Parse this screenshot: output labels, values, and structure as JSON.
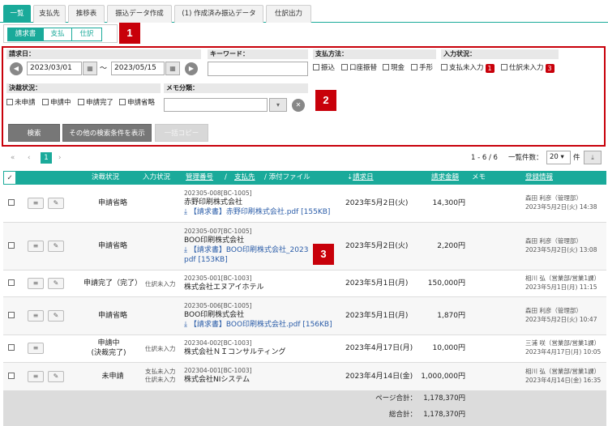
{
  "tabs": [
    {
      "label": "一覧",
      "active": true
    },
    {
      "label": "支払先"
    },
    {
      "label": "推移表"
    },
    {
      "label": "振込データ作成"
    },
    {
      "label": "(1) 作成済み振込データ"
    },
    {
      "label": "仕訳出力"
    }
  ],
  "subtabs": [
    {
      "label": "請求書",
      "active": true
    },
    {
      "label": "支払"
    },
    {
      "label": "仕訳"
    }
  ],
  "callouts": [
    "1",
    "2",
    "3"
  ],
  "search": {
    "date_label": "請求日：",
    "date_from": "2023/03/01",
    "date_sep": "～",
    "date_to": "2023/05/15",
    "keyword_label": "キーワード：",
    "keyword_value": "",
    "paymethod_label": "支払方法：",
    "paymethods": [
      "振込",
      "口座振替",
      "現金",
      "手形"
    ],
    "input_label": "入力状況：",
    "input_opts": [
      {
        "label": "支払未入力",
        "badge": "1"
      },
      {
        "label": "仕訳未入力",
        "badge": "3"
      }
    ],
    "approval_label": "決裁状況：",
    "approval_opts": [
      "未申請",
      "申請中",
      "申請完了",
      "申請省略"
    ],
    "memo_label": "メモ分類：",
    "memo_value": "",
    "search_btn": "検索",
    "more_btn": "その他の検索条件を表示",
    "copy_btn": "一括コピー"
  },
  "pager": {
    "first": "«",
    "prev": "‹",
    "current": "1",
    "next": "›",
    "range": "1 - 6 / 6",
    "per_label": "一覧件数：",
    "per_value": "20",
    "per_unit": "件"
  },
  "columns": {
    "check": "✓",
    "approval": "決裁状況",
    "input": "入力状況",
    "mgmt_no": "管理番号",
    "sep1": "/",
    "payee": "支払先",
    "sep2": "/ 添付ファイル",
    "date": "請求日",
    "amount": "請求金額",
    "memo": "メモ",
    "reg": "登録情報"
  },
  "rows": [
    {
      "approval": "申請省略",
      "approval2": "",
      "input1": "",
      "input2": "",
      "id": "202305-008[BC-1005]",
      "company": "赤野印刷株式会社",
      "file": "【請求書】赤野印刷株式会社.pdf [155KB]",
      "file2": "",
      "date": "2023年5月2日(火)",
      "amount": "14,300円",
      "user": "森田 利彦（管理部）",
      "ts": "2023年5月2日(火) 14:38",
      "edit": true
    },
    {
      "approval": "申請省略",
      "approval2": "",
      "input1": "",
      "input2": "",
      "id": "202305-007[BC-1005]",
      "company": "BOO印刷株式会社",
      "file": "【請求書】BOO印刷株式会社_2023",
      "file2": "pdf [153KB]",
      "date": "2023年5月2日(火)",
      "amount": "2,200円",
      "user": "森田 利彦（管理部）",
      "ts": "2023年5月2日(火) 13:08",
      "edit": true
    },
    {
      "approval": "申請完了（完了）",
      "approval2": "",
      "input1": "仕訳未入力",
      "input2": "",
      "id": "202305-001[BC-1003]",
      "company": "株式会社エヌアイホテル",
      "file": "",
      "file2": "",
      "date": "2023年5月1日(月)",
      "amount": "150,000円",
      "user": "相川 弘（営業部/営業1課）",
      "ts": "2023年5月1日(月) 11:15",
      "edit": true
    },
    {
      "approval": "申請省略",
      "approval2": "",
      "input1": "",
      "input2": "",
      "id": "202305-006[BC-1005]",
      "company": "BOO印刷株式会社",
      "file": "【請求書】BOO印刷株式会社.pdf [156KB]",
      "file2": "",
      "date": "2023年5月1日(月)",
      "amount": "1,870円",
      "user": "森田 利彦（管理部）",
      "ts": "2023年5月2日(火) 10:47",
      "edit": true
    },
    {
      "approval": "申請中",
      "approval2": "(決裁完了)",
      "input1": "仕訳未入力",
      "input2": "",
      "id": "202304-002[BC-1003]",
      "company": "株式会社ＮＩコンサルティング",
      "file": "",
      "file2": "",
      "date": "2023年4月17日(月)",
      "amount": "10,000円",
      "user": "三浦 咲（営業部/営業1課）",
      "ts": "2023年4月17日(月) 10:05",
      "edit": false
    },
    {
      "approval": "未申請",
      "approval2": "",
      "input1": "支払未入力",
      "input2": "仕訳未入力",
      "id": "202304-001[BC-1003]",
      "company": "株式会社NIシステム",
      "file": "",
      "file2": "",
      "date": "2023年4月14日(金)",
      "amount": "1,000,000円",
      "user": "相川 弘（営業部/営業1課）",
      "ts": "2023年4月14日(金) 16:35",
      "edit": true
    }
  ],
  "totals": {
    "page_label": "ページ合計：",
    "page_value": "1,178,370円",
    "total_label": "総合計：",
    "total_value": "1,178,370円"
  },
  "colors": {
    "accent": "#1aaa9a",
    "callout": "#c8000a"
  }
}
